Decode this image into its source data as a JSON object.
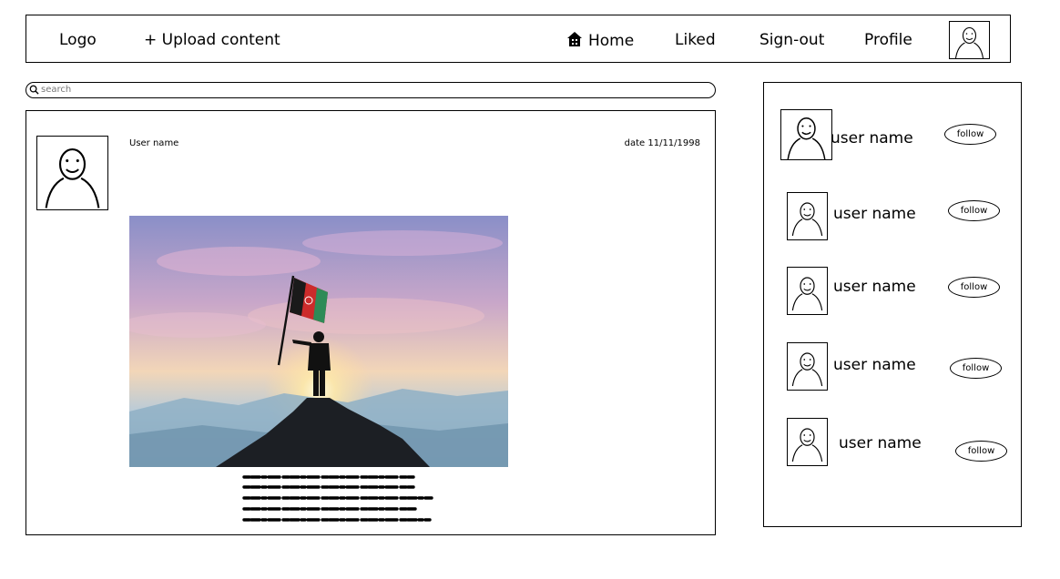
{
  "nav": {
    "logo": "Logo",
    "upload": "+ Upload content",
    "home": "Home",
    "liked": "Liked",
    "signout": "Sign-out",
    "profile": "Profile"
  },
  "search": {
    "placeholder": "search"
  },
  "post": {
    "username": "User name",
    "date": "date 11/11/1998"
  },
  "suggestions": [
    {
      "name": "user name",
      "follow": "follow"
    },
    {
      "name": "user name",
      "follow": "follow"
    },
    {
      "name": "user name",
      "follow": "follow"
    },
    {
      "name": "user name",
      "follow": "follow"
    },
    {
      "name": "user name",
      "follow": "follow"
    }
  ]
}
